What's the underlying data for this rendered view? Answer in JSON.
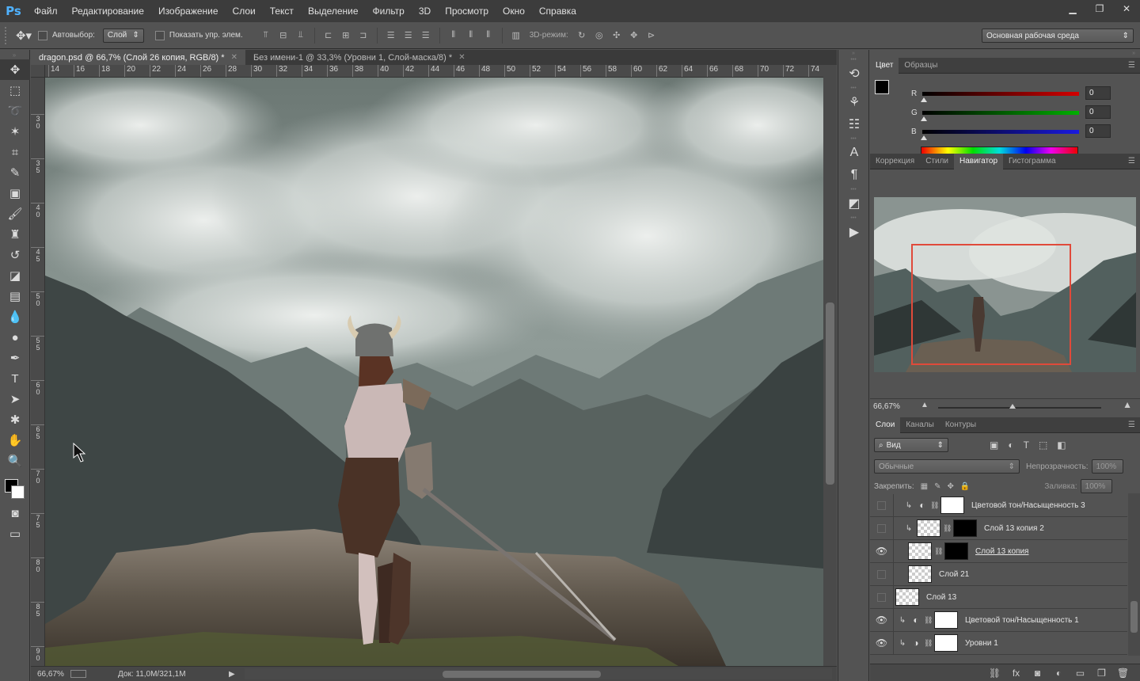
{
  "app": {
    "logo": "Ps"
  },
  "menu": [
    "Файл",
    "Редактирование",
    "Изображение",
    "Слои",
    "Текст",
    "Выделение",
    "Фильтр",
    "3D",
    "Просмотр",
    "Окно",
    "Справка"
  ],
  "window_controls": {
    "minimize": "▁",
    "restore": "❐",
    "close": "✕"
  },
  "options": {
    "autoselect_label": "Автовыбор:",
    "autoselect_value": "Слой",
    "show_controls_label": "Показать упр. элем.",
    "mode3d_label": "3D-режим:",
    "workspace": "Основная рабочая среда"
  },
  "document_tabs": [
    {
      "title": "dragon.psd @ 66,7% (Слой 26 копия, RGB/8) *",
      "active": true
    },
    {
      "title": "Без имени-1 @ 33,3% (Уровни 1, Слой-маска/8) *",
      "active": false
    }
  ],
  "ruler_h": [
    "14",
    "16",
    "18",
    "20",
    "22",
    "24",
    "26",
    "28",
    "30",
    "32",
    "34",
    "36",
    "38",
    "40",
    "42",
    "44",
    "46",
    "48",
    "50",
    "52",
    "54",
    "56",
    "58",
    "60",
    "62",
    "64",
    "66",
    "68",
    "70",
    "72",
    "74"
  ],
  "ruler_v": [
    [
      "3",
      "0"
    ],
    [
      "3",
      "5"
    ],
    [
      "4",
      "0"
    ],
    [
      "4",
      "5"
    ],
    [
      "5",
      "0"
    ],
    [
      "5",
      "5"
    ],
    [
      "6",
      "0"
    ],
    [
      "6",
      "5"
    ],
    [
      "7",
      "0"
    ],
    [
      "7",
      "5"
    ],
    [
      "8",
      "0"
    ],
    [
      "8",
      "5"
    ],
    [
      "9",
      "0"
    ]
  ],
  "status": {
    "zoom": "66,67%",
    "doc": "Док: 11,0M/321,1M",
    "arrow": "▶"
  },
  "color_panel": {
    "tabs": [
      "Цвет",
      "Образцы"
    ],
    "sliders": [
      {
        "label": "R",
        "value": "0",
        "color": "#d40000"
      },
      {
        "label": "G",
        "value": "0",
        "color": "#00b000"
      },
      {
        "label": "B",
        "value": "0",
        "color": "#1a1ae0"
      }
    ]
  },
  "nav_panel": {
    "tabs": [
      "Коррекция",
      "Стили",
      "Навигатор",
      "Гистограмма"
    ],
    "active_tab": "Навигатор",
    "zoom": "66,67%"
  },
  "layers_panel": {
    "tabs": [
      "Слои",
      "Каналы",
      "Контуры"
    ],
    "filter_label": "Вид",
    "blend_mode": "Обычные",
    "opacity_label": "Непрозрачность:",
    "opacity_value": "100%",
    "lock_label": "Закрепить:",
    "fill_label": "Заливка:",
    "fill_value": "100%",
    "layers": [
      {
        "name": "Цветовой тон/Насыщенность 3",
        "visible": false
      },
      {
        "name": "Слой 13 копия 2",
        "visible": false
      },
      {
        "name": "Слой 13 копия",
        "visible": true
      },
      {
        "name": "Слой 21",
        "visible": false
      },
      {
        "name": "Слой 13",
        "visible": false
      },
      {
        "name": "Цветовой тон/Насыщенность 1",
        "visible": true
      },
      {
        "name": "Уровни 1",
        "visible": true
      }
    ]
  }
}
